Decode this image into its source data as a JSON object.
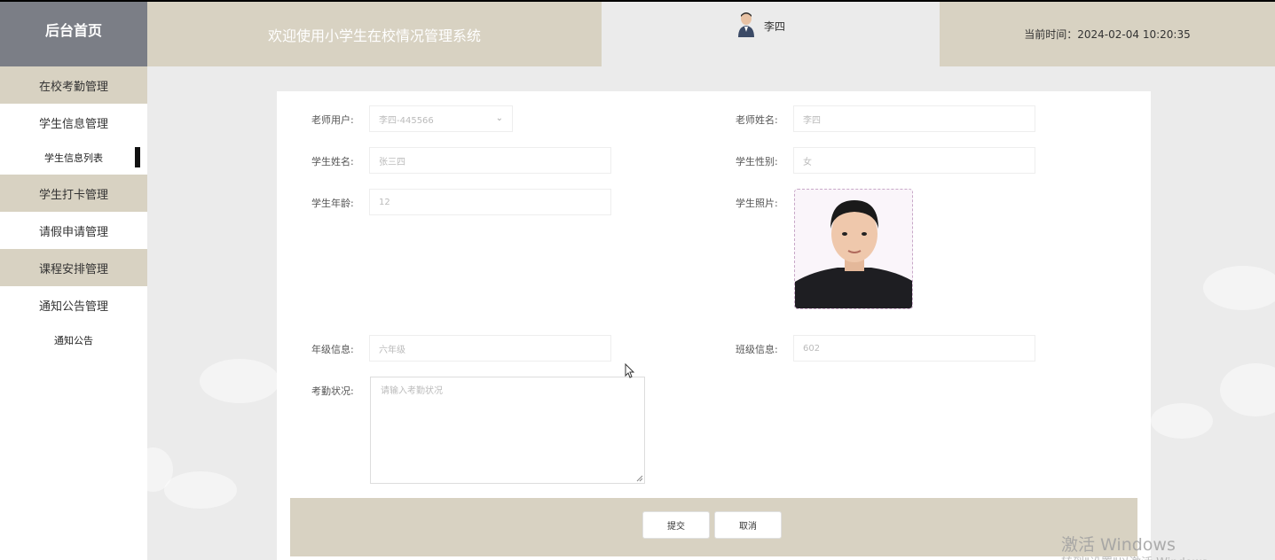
{
  "header": {
    "brand": "后台首页",
    "welcome": "欢迎使用小学生在校情况管理系统",
    "user_name": "李四",
    "time_text": "当前时间：2024-02-04 10:20:35"
  },
  "sidebar": {
    "items": [
      {
        "label": "在校考勤管理"
      },
      {
        "label": "学生信息管理"
      },
      {
        "label": "学生信息列表"
      },
      {
        "label": "学生打卡管理"
      },
      {
        "label": "请假申请管理"
      },
      {
        "label": "课程安排管理"
      },
      {
        "label": "通知公告管理"
      },
      {
        "label": "通知公告"
      }
    ]
  },
  "form": {
    "teacher_user_label": "老师用户:",
    "teacher_user_value": "李四-445566",
    "teacher_name_label": "老师姓名:",
    "teacher_name_value": "李四",
    "student_name_label": "学生姓名:",
    "student_name_value": "张三四",
    "student_gender_label": "学生性别:",
    "student_gender_value": "女",
    "student_age_label": "学生年龄:",
    "student_age_value": "12",
    "student_photo_label": "学生照片:",
    "grade_label": "年级信息:",
    "grade_value": "六年级",
    "class_label": "班级信息:",
    "class_value": "602",
    "attendance_label": "考勤状况:",
    "attendance_placeholder": "请输入考勤状况"
  },
  "buttons": {
    "submit": "提交",
    "cancel": "取消"
  },
  "watermark": {
    "line1": "激活 Windows",
    "line2": "转到\"设置\"以激活 Windows"
  }
}
